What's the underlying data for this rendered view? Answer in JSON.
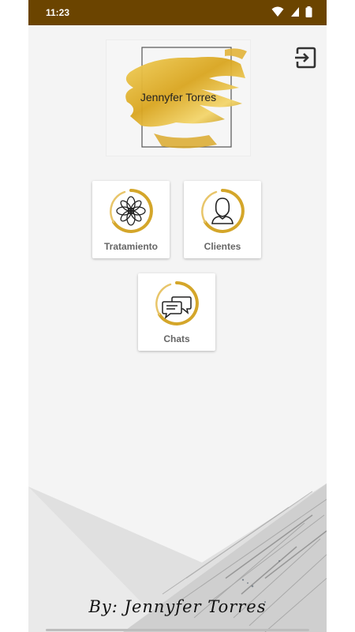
{
  "status_bar": {
    "time": "11:23",
    "background": "#6b4400",
    "icons": [
      "wifi-icon",
      "signal-icon",
      "battery-icon"
    ]
  },
  "logo": {
    "name": "Jennyfer Torres",
    "accent": "#d4a62a"
  },
  "header": {
    "logout_icon": "logout-icon"
  },
  "menu": {
    "items": [
      {
        "label": "Tratamiento",
        "icon": "flower-icon"
      },
      {
        "label": "Clientes",
        "icon": "person-icon"
      },
      {
        "label": "Chats",
        "icon": "chat-bubbles-icon"
      }
    ],
    "ring_color": "#d4a62a"
  },
  "footer": {
    "signature": "By: Jennyfer Torres"
  }
}
